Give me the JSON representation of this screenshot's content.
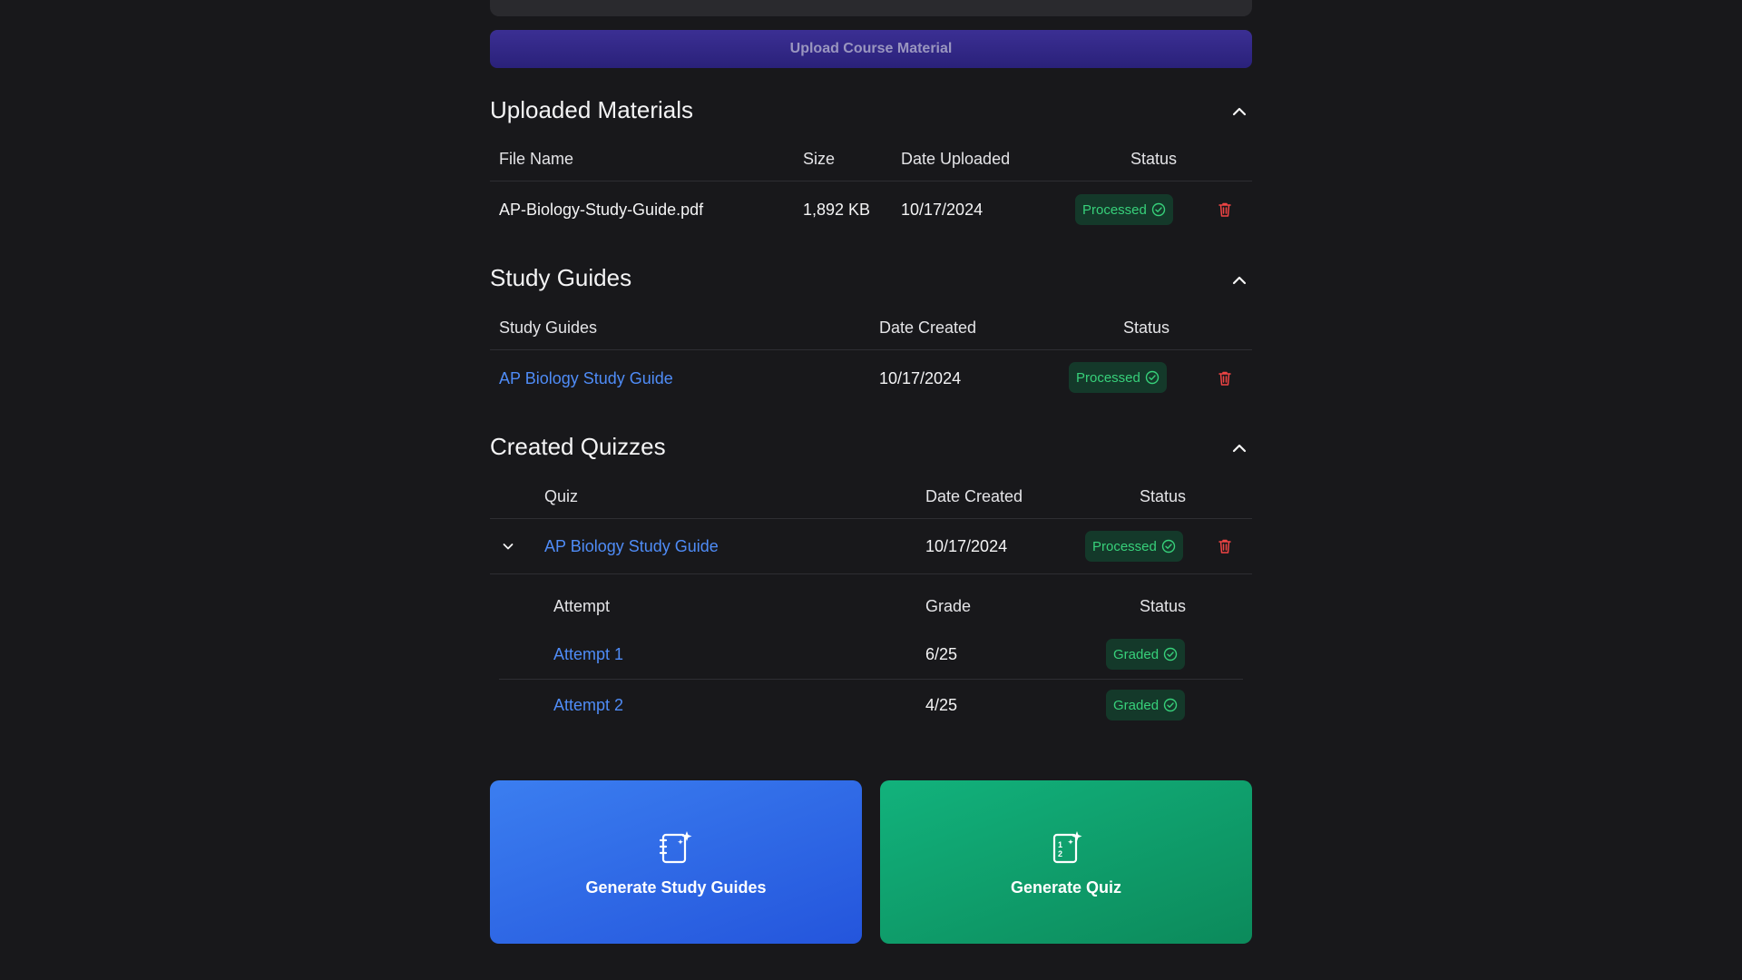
{
  "upload": {
    "button_label": "Upload Course Material"
  },
  "uploaded_materials": {
    "title": "Uploaded Materials",
    "headers": {
      "file_name": "File Name",
      "size": "Size",
      "date": "Date Uploaded",
      "status": "Status"
    },
    "rows": [
      {
        "file_name": "AP-Biology-Study-Guide.pdf",
        "size": "1,892 KB",
        "date": "10/17/2024",
        "status": "Processed"
      }
    ]
  },
  "study_guides": {
    "title": "Study Guides",
    "headers": {
      "name": "Study Guides",
      "date": "Date Created",
      "status": "Status"
    },
    "rows": [
      {
        "name": "AP Biology Study Guide",
        "date": "10/17/2024",
        "status": "Processed"
      }
    ]
  },
  "quizzes": {
    "title": "Created Quizzes",
    "headers": {
      "quiz": "Quiz",
      "date": "Date Created",
      "status": "Status"
    },
    "rows": [
      {
        "name": "AP Biology Study Guide",
        "date": "10/17/2024",
        "status": "Processed",
        "attempts_headers": {
          "attempt": "Attempt",
          "grade": "Grade",
          "status": "Status"
        },
        "attempts": [
          {
            "name": "Attempt 1",
            "grade": "6/25",
            "status": "Graded"
          },
          {
            "name": "Attempt 2",
            "grade": "4/25",
            "status": "Graded"
          }
        ]
      }
    ]
  },
  "actions": {
    "study_guides_label": "Generate Study Guides",
    "quiz_label": "Generate Quiz"
  },
  "colors": {
    "background": "#18181b",
    "link": "#4f8cf7",
    "badge_text": "#37d07a",
    "badge_bg": "#14392a",
    "trash": "#ef4444",
    "upload_button": "#2f2585",
    "card_blue": "#2e6ae6",
    "card_green": "#10a06b"
  }
}
